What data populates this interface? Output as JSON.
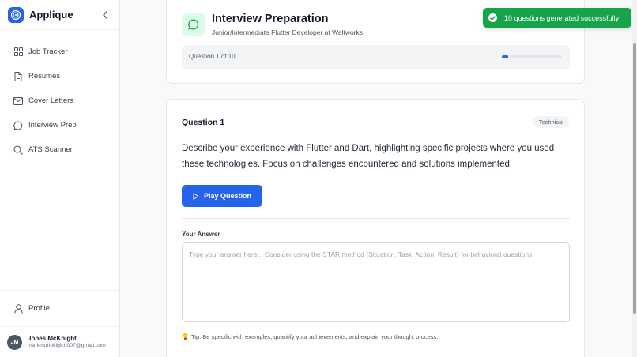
{
  "app": {
    "name": "Applique",
    "logo_icon": "target-icon",
    "accent_color": "#2563eb"
  },
  "sidebar": {
    "items": [
      {
        "label": "Job Tracker",
        "icon": "grid-icon"
      },
      {
        "label": "Resumes",
        "icon": "file-icon"
      },
      {
        "label": "Cover Letters",
        "icon": "mail-icon"
      },
      {
        "label": "Interview Prep",
        "icon": "chat-icon"
      },
      {
        "label": "ATS Scanner",
        "icon": "search-icon"
      }
    ],
    "profile_label": "Profile",
    "user": {
      "initials": "JM",
      "name": "Jones McKnight",
      "email": "markmuriukigich007@gmail.com"
    }
  },
  "header": {
    "title": "Interview Preparation",
    "subtitle": "Junior/Intermediate Flutter Developer at Waltworks",
    "progress_text": "Question 1 of 10",
    "progress_fraction": 0.1
  },
  "question": {
    "title": "Question 1",
    "tag": "Technical",
    "text": "Describe your experience with Flutter and Dart, highlighting specific projects where you used these technologies. Focus on challenges encountered and solutions implemented.",
    "play_label": "Play Question",
    "answer_label": "Your Answer",
    "answer_placeholder": "Type your answer here... Consider using the STAR method (Situation, Task, Action, Result) for behavioral questions.",
    "answer_value": "",
    "tip": "Tip: Be specific with examples, quantify your achievements, and explain your thought process."
  },
  "toast": {
    "message": "10 questions generated successfully!",
    "color": "#16a34a"
  }
}
